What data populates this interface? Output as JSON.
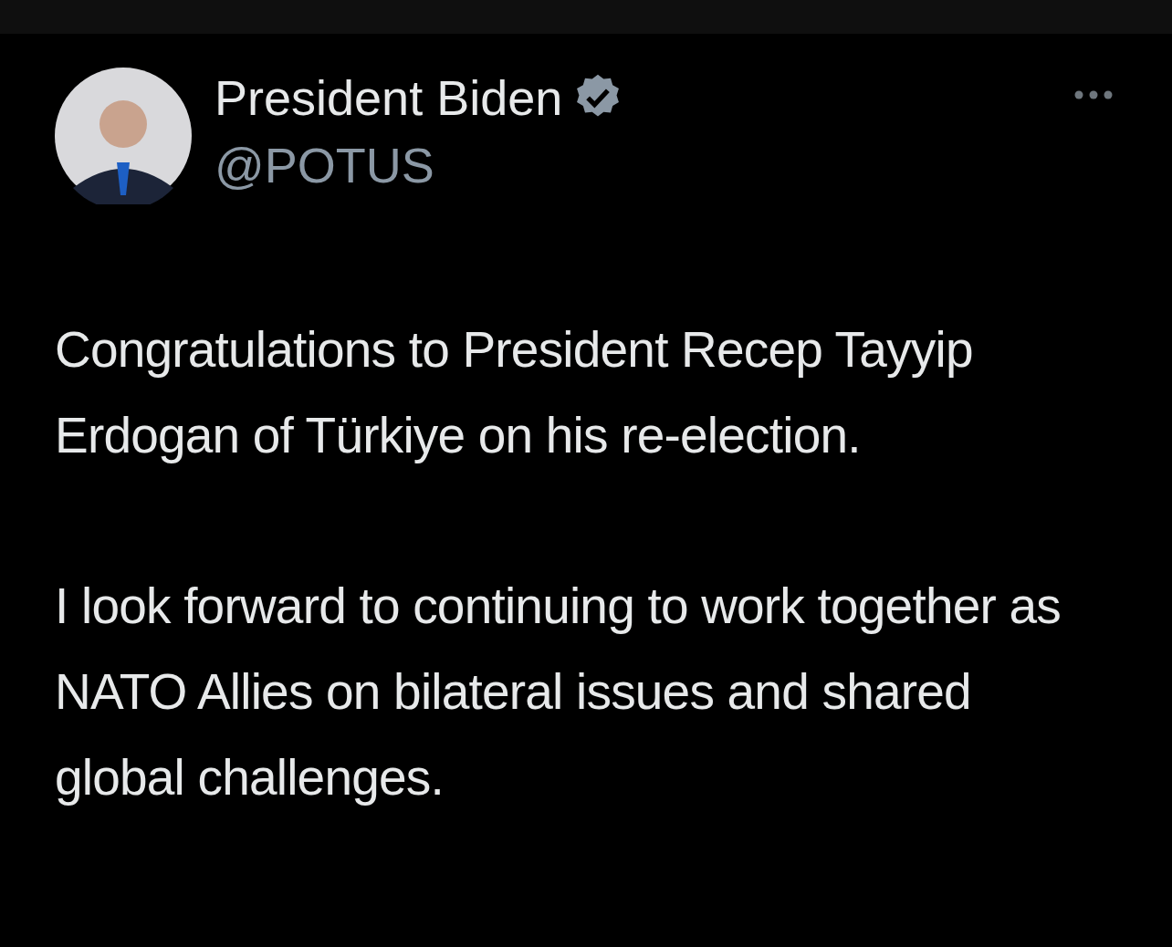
{
  "tweet": {
    "author": {
      "name": "President Biden",
      "handle": "@POTUS",
      "verified": true
    },
    "paragraphs": [
      "Congratulations to President Recep Tayyip Erdogan of Türkiye on his re-election.",
      "I look forward to continuing to work together as NATO Allies on bilateral issues and shared global challenges."
    ]
  }
}
